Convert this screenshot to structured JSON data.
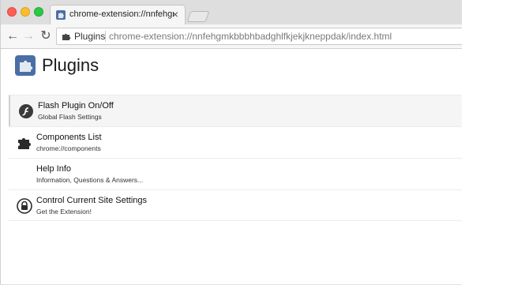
{
  "tab": {
    "title": "chrome-extension://nnfehgmk",
    "close": "×"
  },
  "toolbar": {
    "back": "←",
    "forward": "→",
    "reload": "↻",
    "omnibox_chip": "Plugins",
    "url": "chrome-extension://nnfehgmkbbbhbadghlfkjekjkneppdak/index.html"
  },
  "page": {
    "title": "Plugins"
  },
  "items": [
    {
      "title": "Flash Plugin On/Off",
      "subtitle": "Global Flash Settings",
      "icon": "flash-icon"
    },
    {
      "title": "Components List",
      "subtitle": "chrome://components",
      "icon": "puzzle-icon"
    },
    {
      "title": "Help Info",
      "subtitle": "Information, Questions & Answers...",
      "icon": "none"
    },
    {
      "title": "Control Current Site Settings",
      "subtitle": "Get the Extension!",
      "icon": "lock-icon"
    }
  ],
  "colors": {
    "traffic_red": "#fc5f57",
    "traffic_yellow": "#fdbc2e",
    "traffic_green": "#29c941",
    "icon_blue": "#4a6fa5"
  }
}
